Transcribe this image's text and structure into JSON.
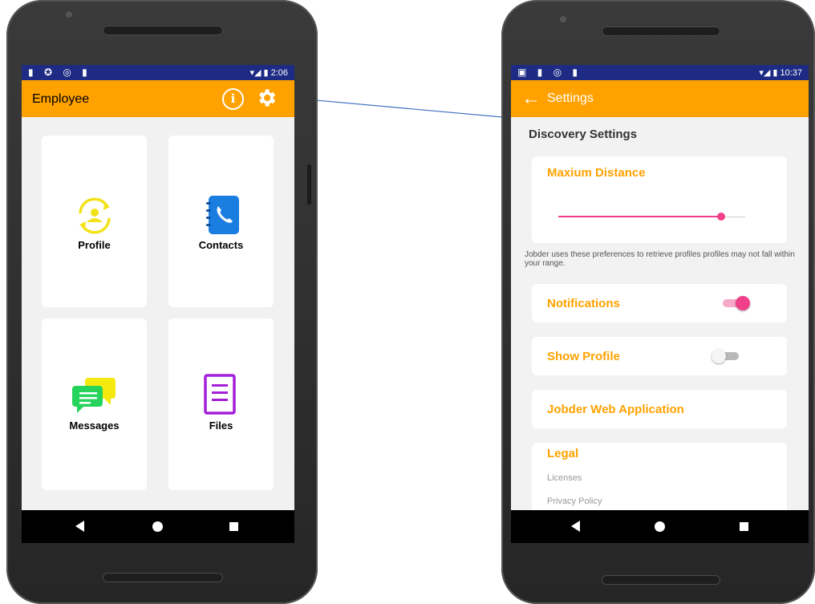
{
  "colors": {
    "accent": "#ffa200",
    "status_bar": "#1d2b84",
    "toggle_on": "#f0408a",
    "background": "#f2f2f2"
  },
  "left_phone": {
    "status_bar": {
      "icons": "▮ ✪ ◎ ▮",
      "right": "▾◢ ▮ 2:06"
    },
    "app_bar": {
      "title": "Employee",
      "info_icon": "info-icon",
      "settings_icon": "gear-icon",
      "info_glyph": "i"
    },
    "tiles": [
      {
        "label": "Profile",
        "icon": "profile-sync-icon"
      },
      {
        "label": "Contacts",
        "icon": "contacts-book-icon"
      },
      {
        "label": "Messages",
        "icon": "chat-bubbles-icon"
      },
      {
        "label": "Files",
        "icon": "document-icon"
      }
    ]
  },
  "right_phone": {
    "status_bar": {
      "icons": "▣ ▮ ◎ ▮",
      "right": "▾◢ ▮ 10:37"
    },
    "app_bar": {
      "back_glyph": "←",
      "title": "Settings"
    },
    "section_title": "Discovery Settings",
    "max_distance": {
      "heading": "Maxium Distance",
      "value_fraction": 0.87
    },
    "helper_text": "Jobder uses these preferences to retrieve profiles  profiles may not fall within your range.",
    "notifications": {
      "label": "Notifications",
      "enabled": true
    },
    "show_profile": {
      "label": "Show Profile",
      "enabled": false
    },
    "web_app": {
      "label": "Jobder Web Application"
    },
    "legal": {
      "heading": "Legal",
      "links": [
        "Licenses",
        "Privacy Policy"
      ]
    }
  }
}
